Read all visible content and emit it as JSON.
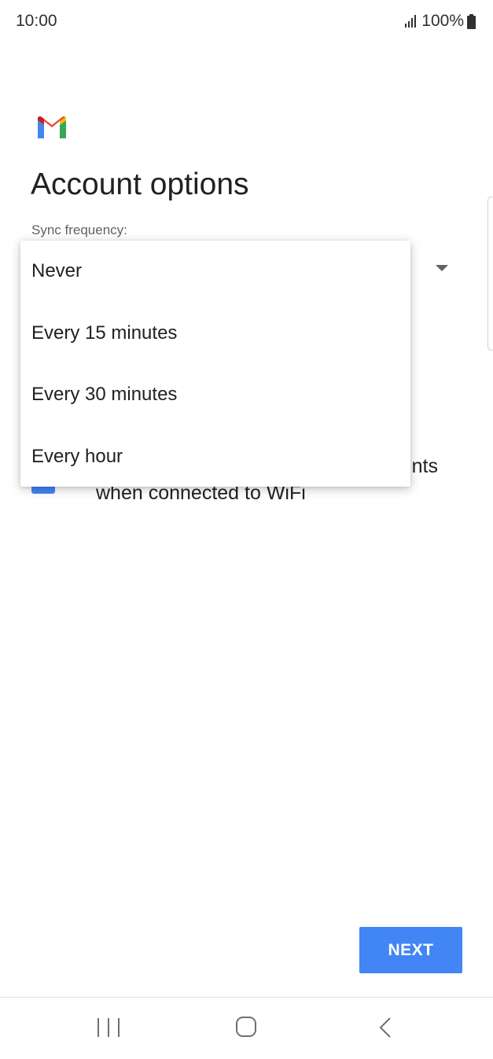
{
  "status_bar": {
    "time": "10:00",
    "battery_text": "100%",
    "icons": [
      "signal-icon",
      "battery-icon"
    ]
  },
  "header": {
    "logo": "gmail-logo",
    "title": "Account options"
  },
  "sync": {
    "label": "Sync frequency:",
    "dropdown_icon": "dropdown-arrow-icon",
    "options": [
      "Never",
      "Every 15 minutes",
      "Every 30 minutes",
      "Every hour"
    ]
  },
  "attachments": {
    "visible_fragment": "nts",
    "second_line": "when connected to WiFi",
    "checked": true
  },
  "footer": {
    "next_label": "NEXT"
  },
  "nav_bar": {
    "icons": [
      "recents-icon",
      "home-icon",
      "back-icon"
    ]
  },
  "colors": {
    "accent": "#4285f4",
    "text_primary": "#202124",
    "text_secondary": "#5f6368",
    "background": "#ffffff"
  }
}
